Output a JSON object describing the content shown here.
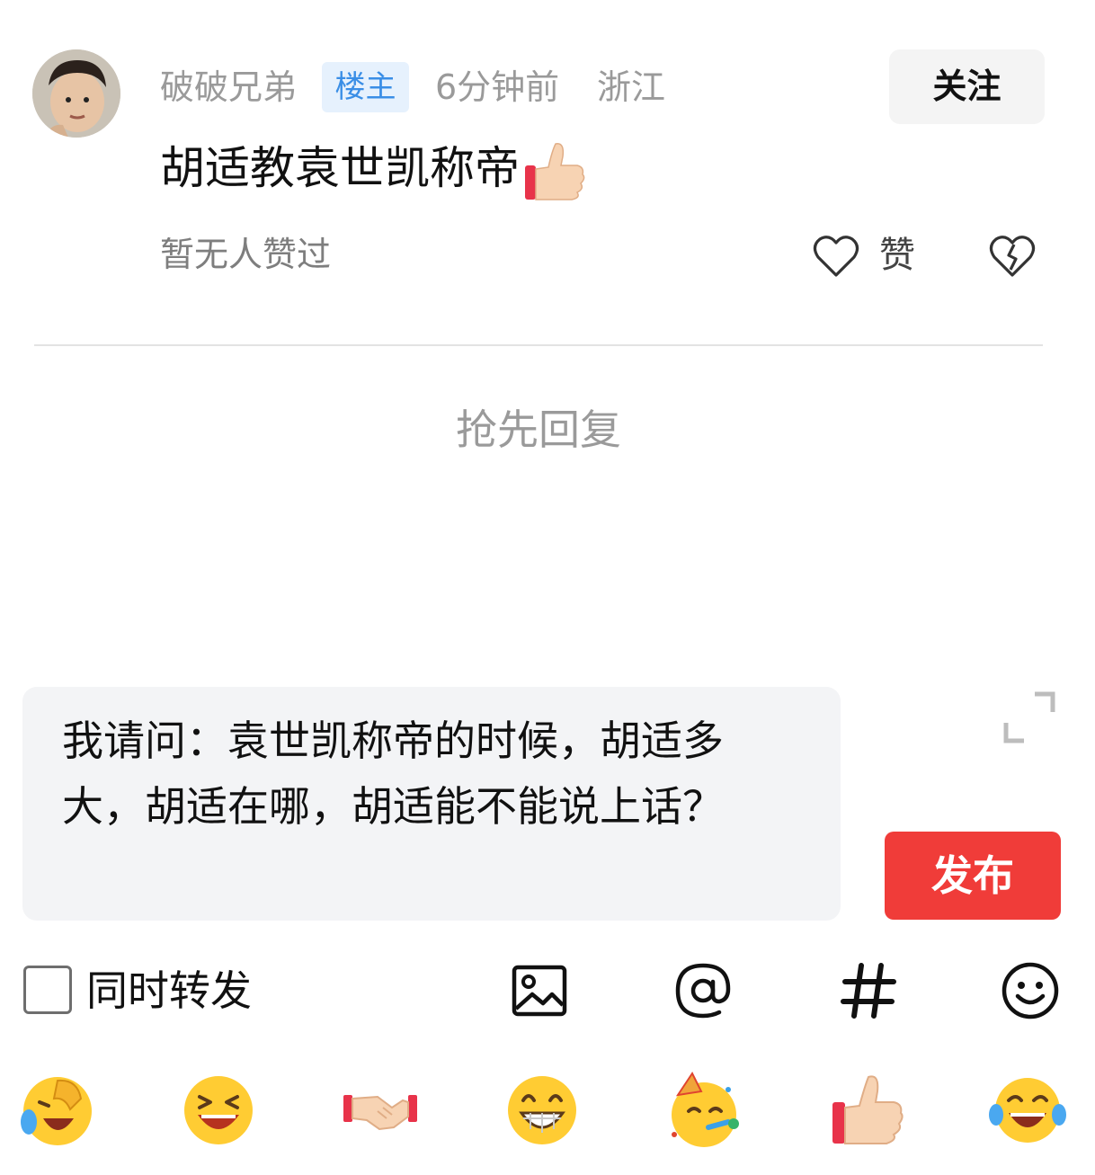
{
  "post": {
    "username": "破破兄弟",
    "op_badge": "楼主",
    "time": "6分钟前",
    "location": "浙江",
    "follow_label": "关注",
    "comment_text": "胡适教袁世凯称帝",
    "comment_emoji": "thumbs-up-icon",
    "no_likes_text": "暂无人赞过",
    "like_label": "赞"
  },
  "thread": {
    "first_reply_prompt": "抢先回复"
  },
  "composer": {
    "reply_text": "我请问：袁世凯称帝的时候，胡适多大，胡适在哪，胡适能不能说上话？",
    "publish_label": "发布",
    "repost_label": "同时转发",
    "repost_checked": false,
    "toolbar_icons": [
      "image-icon",
      "at-icon",
      "hashtag-icon",
      "smiley-icon"
    ]
  },
  "emoji_bar": [
    "laughing-face-icon",
    "grinning-squint-icon",
    "handshake-icon",
    "beaming-grin-icon",
    "partying-face-icon",
    "thumbs-up-icon",
    "tears-of-joy-icon"
  ],
  "colors": {
    "accent_red": "#f03c39",
    "badge_blue": "#3a8ee6",
    "badge_bg": "#e6f1fd",
    "muted_text": "#9a9a9a",
    "input_bg": "#f3f4f6"
  }
}
